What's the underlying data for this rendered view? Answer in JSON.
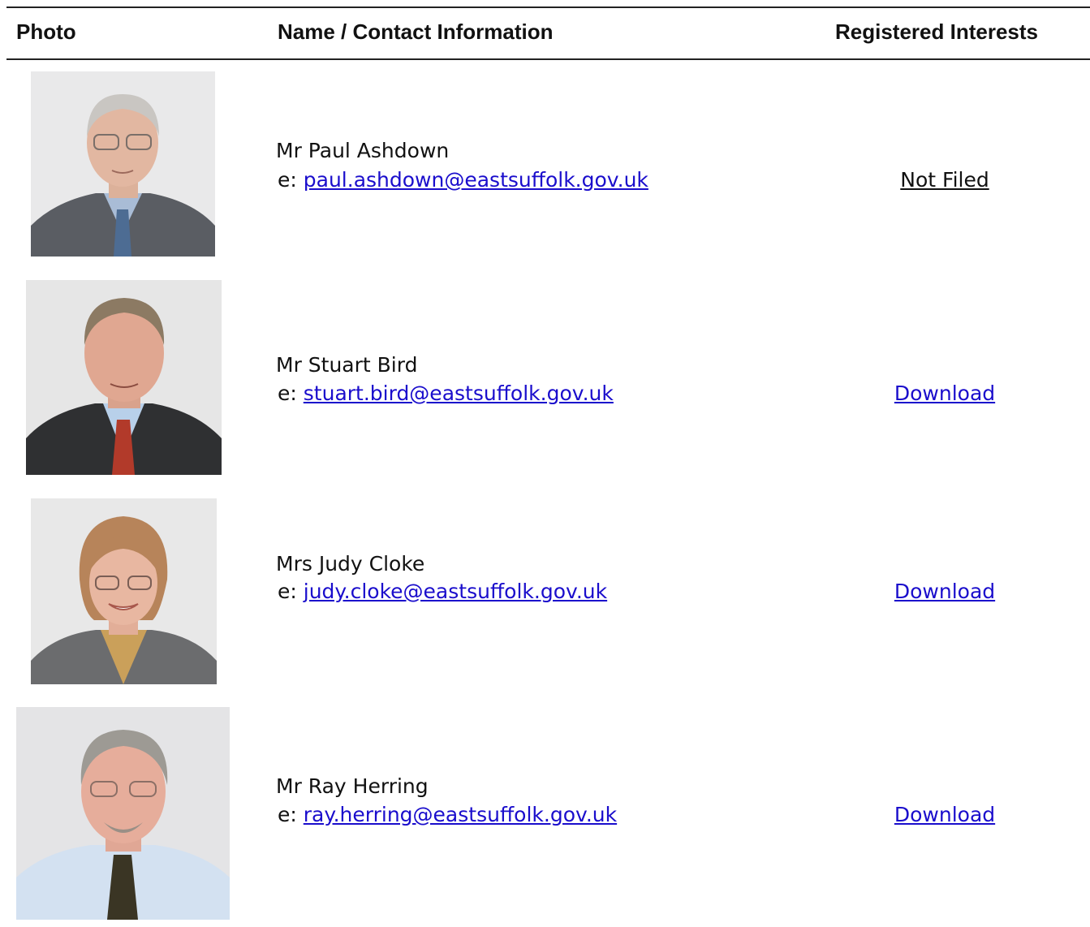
{
  "table": {
    "headers": {
      "photo": "Photo",
      "name_contact": "Name / Contact Information",
      "interests": "Registered Interests"
    },
    "rows": [
      {
        "name": "Mr Paul Ashdown",
        "email_prefix": "e: ",
        "email": "paul.ashdown@eastsuffolk.gov.uk",
        "interest": "Not Filed",
        "interest_is_link": false,
        "photo_alt": "Photo of Mr Paul Ashdown"
      },
      {
        "name": "Mr Stuart Bird",
        "email_prefix": "e: ",
        "email": "stuart.bird@eastsuffolk.gov.uk",
        "interest": "Download",
        "interest_is_link": true,
        "photo_alt": "Photo of Mr Stuart Bird"
      },
      {
        "name": "Mrs Judy Cloke",
        "email_prefix": "e: ",
        "email": "judy.cloke@eastsuffolk.gov.uk",
        "interest": "Download",
        "interest_is_link": true,
        "photo_alt": "Photo of Mrs Judy Cloke"
      },
      {
        "name": "Mr Ray Herring",
        "email_prefix": "e: ",
        "email": "ray.herring@eastsuffolk.gov.uk",
        "interest": "Download",
        "interest_is_link": true,
        "photo_alt": "Photo of Mr Ray Herring"
      }
    ]
  },
  "colors": {
    "link": "#1a0dcc",
    "text": "#111111",
    "rule": "#222222"
  }
}
